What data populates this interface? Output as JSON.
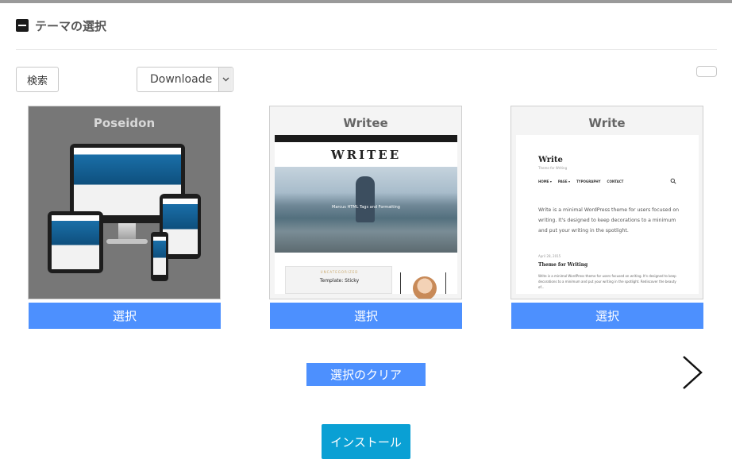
{
  "section": {
    "title": "テーマの選択"
  },
  "toolbar": {
    "search_label": "検索",
    "filter_value": "Downloade"
  },
  "themes": [
    {
      "name": "Poseidon",
      "select_label": "選択"
    },
    {
      "name": "Writee",
      "select_label": "選択",
      "logo": "WRITEE",
      "hero_caption": "Marcus HTML Tags and Formatting",
      "post_tag": "UNCATEGORIZED",
      "post_title": "Template: Sticky"
    },
    {
      "name": "Write",
      "select_label": "選択",
      "site_name": "Write",
      "tagline": "Theme for Writing",
      "nav": [
        "HOME ▾",
        "PAGE ▾",
        "TYPOGRAPHY",
        "CONTACT"
      ],
      "intro": "Write is a minimal WordPress theme for users focused on writing. It's designed to keep decorations to a minimum and put your writing in the spotlight.",
      "post_date": "April 28, 2015",
      "post_title": "Theme for Writing",
      "post_excerpt": "Write is a minimal WordPress theme for users focused on writing. It's designed to keep decorations to a minimum and put your writing in the spotlight. Rediscover the beauty of..."
    }
  ],
  "actions": {
    "clear_label": "選択のクリア",
    "install_label": "インストール"
  },
  "colors": {
    "select_button": "#4d90fe",
    "install_button": "#0aa0d4",
    "top_bar": "#9a9a9a"
  },
  "icons": {
    "collapse": "minus-square-icon",
    "dropdown": "chevron-down-icon",
    "next": "chevron-right-icon"
  }
}
